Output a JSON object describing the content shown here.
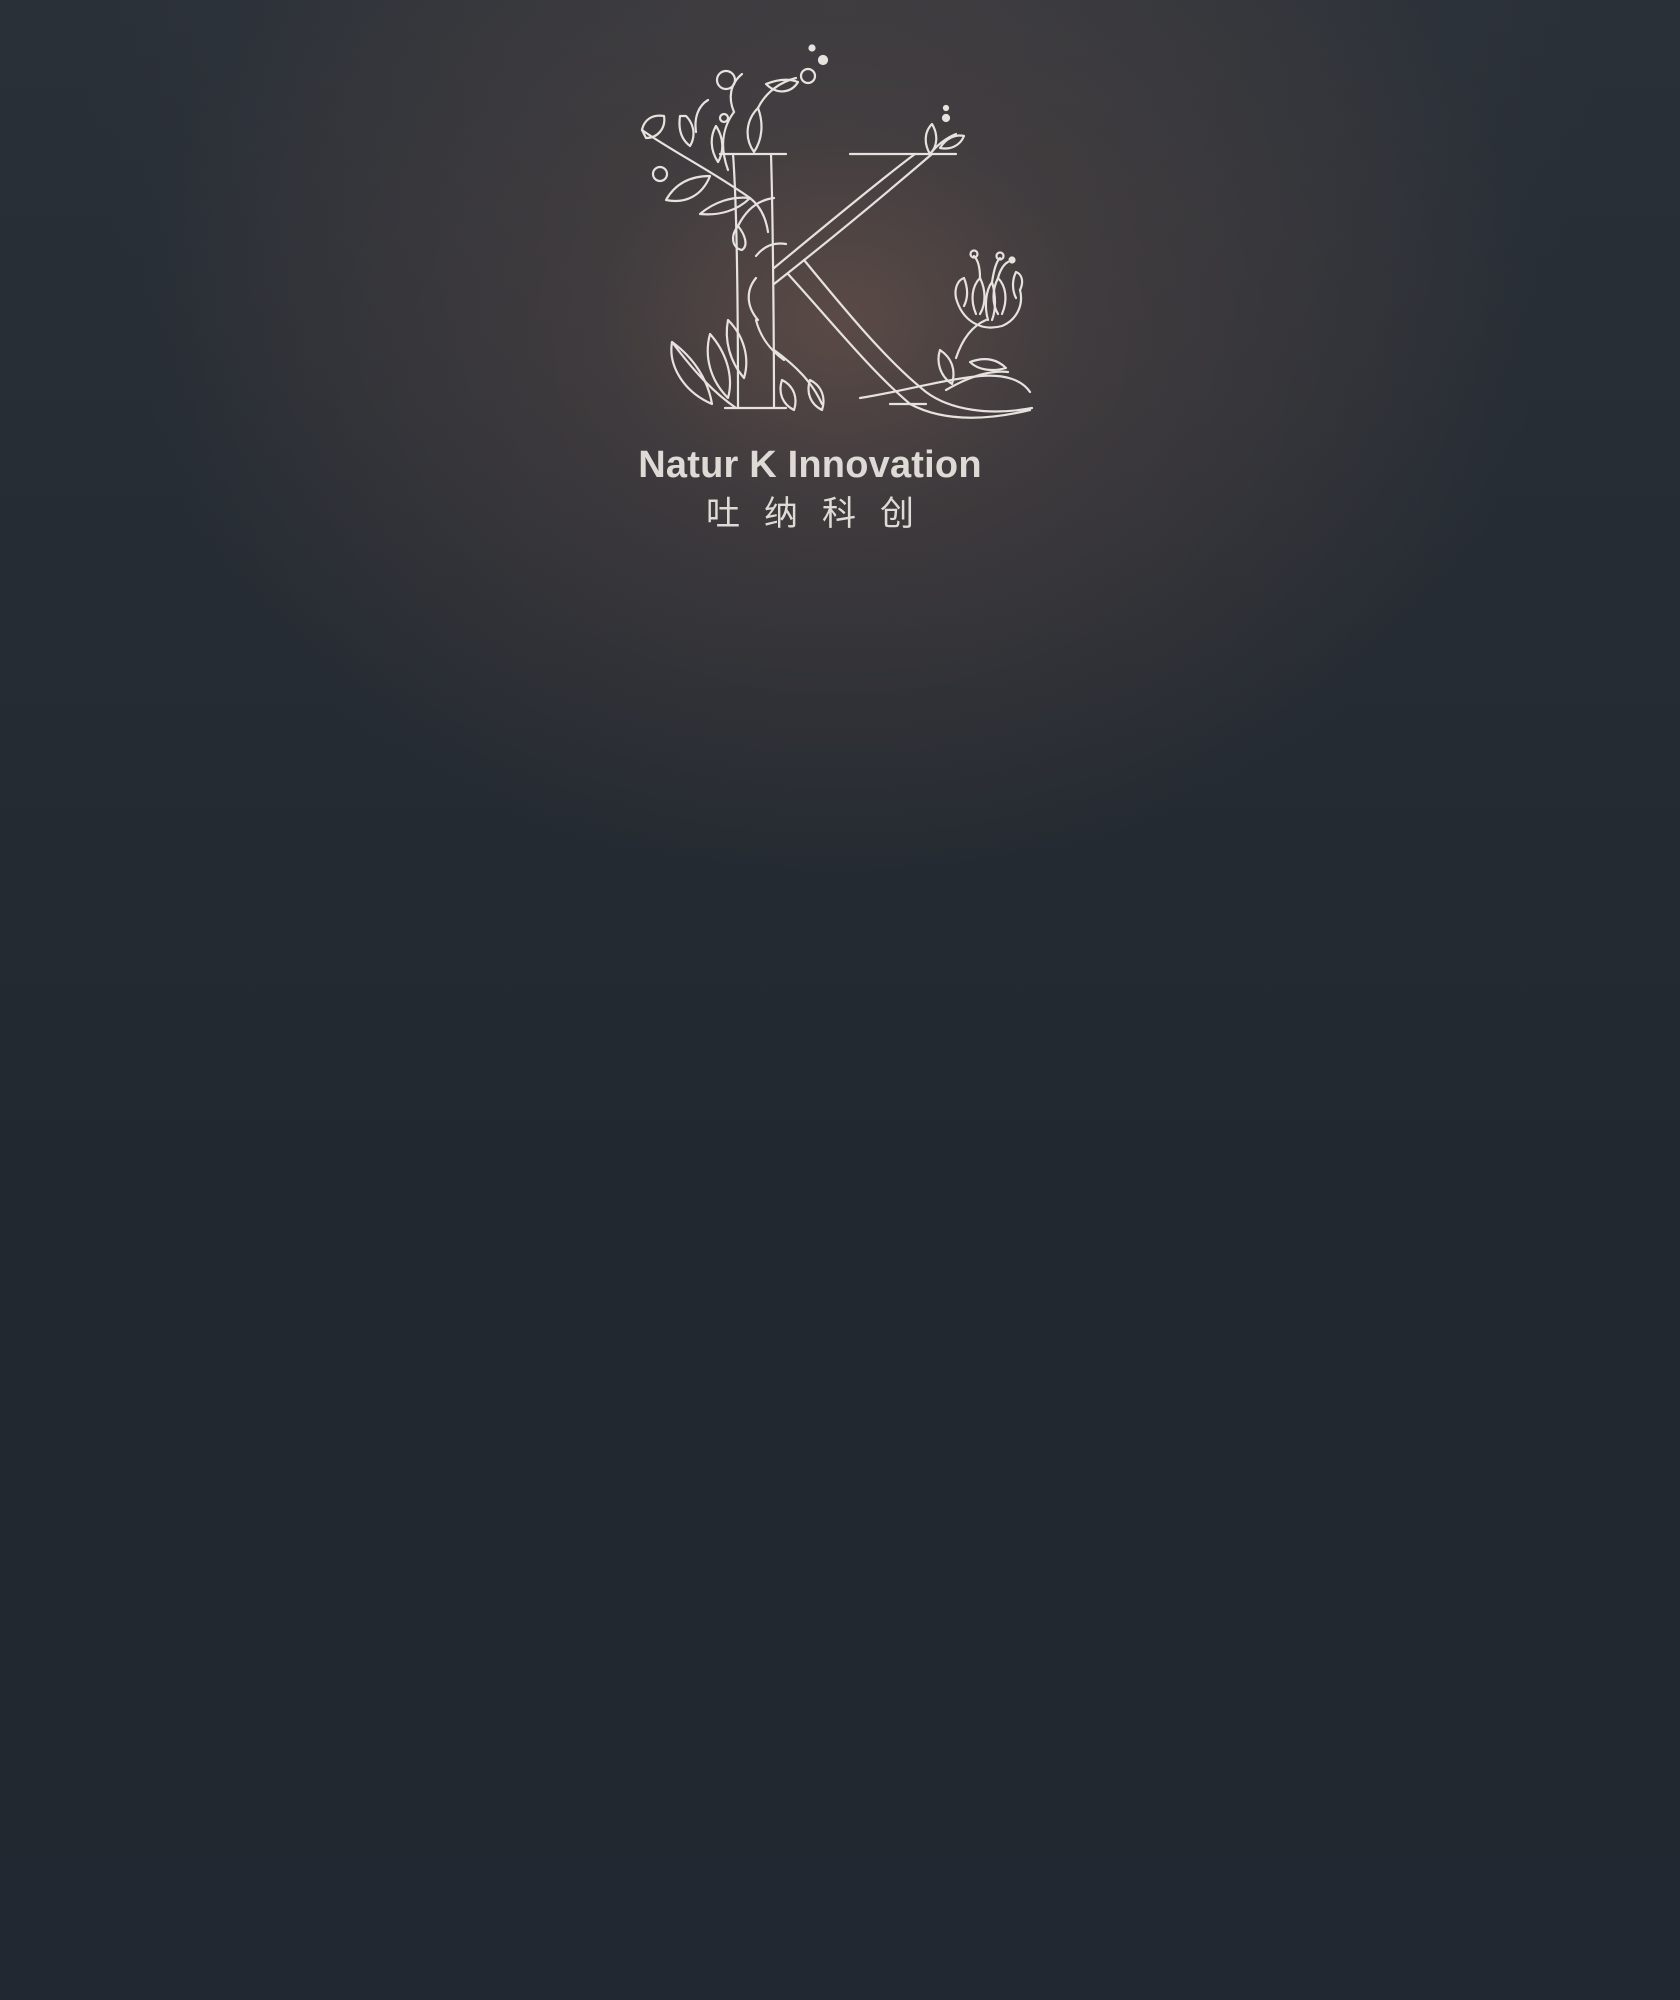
{
  "brand": {
    "logo_icon": "floral-letter-k-icon",
    "logo_letter": "K",
    "name_en": "Natur K Innovation",
    "name_cn": "吐纳科创"
  },
  "colors": {
    "background": "#222831",
    "glow": "#5e4b47",
    "logo_stroke": "#e6e2de",
    "text": "#dedad6"
  }
}
